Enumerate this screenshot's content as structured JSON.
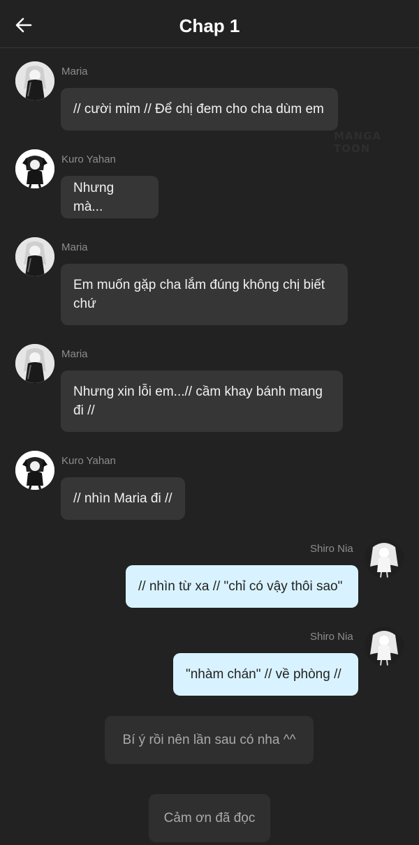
{
  "header": {
    "title": "Chap 1",
    "back_icon": "arrow-left-icon"
  },
  "watermark": "MANGA TOON",
  "colors": {
    "background": "#222222",
    "left_bubble": "#363636",
    "right_bubble": "#d8f3ff",
    "name": "#8d8d8d"
  },
  "messages": [
    {
      "name": "Maria",
      "text": "// cười mỉm // Để chị đem cho cha dùm em",
      "side": "left",
      "avatar": "maria-avatar"
    },
    {
      "name": "Kuro Yahan",
      "text": "Nhưng mà...",
      "side": "left",
      "avatar": "kuro-yahan-avatar"
    },
    {
      "name": "Maria",
      "text": "Em muốn gặp cha lắm đúng không chị biết chứ",
      "side": "left",
      "avatar": "maria-avatar"
    },
    {
      "name": "Maria",
      "text": "Nhưng xin lỗi em...// cầm khay bánh mang đi //",
      "side": "left",
      "avatar": "maria-avatar"
    },
    {
      "name": "Kuro Yahan",
      "text": "// nhìn Maria đi //",
      "side": "left",
      "avatar": "kuro-yahan-avatar"
    },
    {
      "name": "Shiro Nia",
      "text": "// nhìn từ xa // \"chỉ có vậy thôi sao\"",
      "side": "right",
      "avatar": "shiro-nia-avatar"
    },
    {
      "name": "Shiro Nia",
      "text": "\"nhàm chán\" // về phòng //",
      "side": "right",
      "avatar": "shiro-nia-avatar"
    }
  ],
  "notes": [
    {
      "text": "Bí ý rồi nên lần sau có nha ^^"
    },
    {
      "text": "Cảm ơn đã đọc"
    }
  ]
}
